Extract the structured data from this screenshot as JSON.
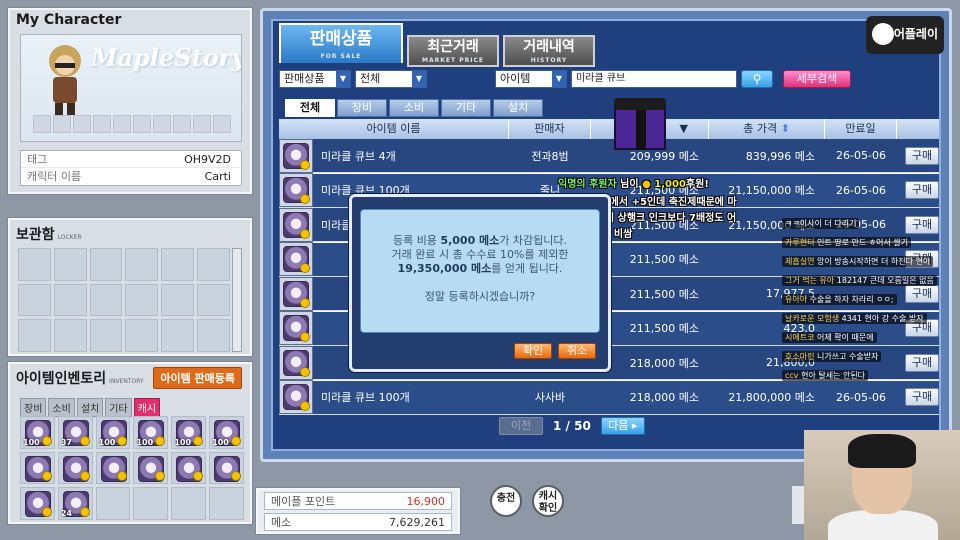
{
  "character": {
    "title": "My Character",
    "watermark": "MapleStory",
    "rows": [
      {
        "key": "태그",
        "value": "OH9V2D"
      },
      {
        "key": "캐릭터 이름",
        "value": "Carti"
      }
    ]
  },
  "locker": {
    "title": "보관함",
    "subtitle": "LOCKER"
  },
  "inventory": {
    "title": "아이템인벤토리",
    "subtitle": "INVENTORY",
    "sell_button": "아이템 판매등록",
    "tabs": [
      "장비",
      "소비",
      "설치",
      "기타",
      "캐시"
    ],
    "active_tab": "캐시",
    "slots": [
      {
        "qty": "100",
        "icon": "cube-icon"
      },
      {
        "qty": "37",
        "icon": "cube-icon"
      },
      {
        "qty": "100",
        "icon": "cube-icon"
      },
      {
        "qty": "100",
        "icon": "cube-icon"
      },
      {
        "qty": "100",
        "icon": "cube-icon"
      },
      {
        "qty": "100",
        "icon": "cube-icon"
      },
      {
        "qty": "",
        "icon": "cube-icon"
      },
      {
        "qty": "",
        "icon": "cube-icon"
      },
      {
        "qty": "",
        "icon": "cube-icon"
      },
      {
        "qty": "",
        "icon": "cube-icon"
      },
      {
        "qty": "",
        "icon": "cube-icon"
      },
      {
        "qty": "",
        "icon": "cube-icon"
      },
      {
        "qty": "",
        "icon": "cube-icon"
      },
      {
        "qty": "24",
        "icon": "cube-icon"
      }
    ]
  },
  "points": {
    "maple_label": "메이플 포인트",
    "maple_value": "16,900",
    "meso_label": "메소",
    "meso_value": "7,629,261"
  },
  "round_buttons": {
    "charge": "충전",
    "cash_check": "캐시\n확인"
  },
  "shop": {
    "tabs": [
      {
        "label": "판매상품",
        "sub": "FOR SALE"
      },
      {
        "label": "최근거래",
        "sub": "MARKET PRICE"
      },
      {
        "label": "거래내역",
        "sub": "HISTORY"
      }
    ],
    "filters": {
      "filter1": "판매상품",
      "filter2": "전체",
      "filter3": "아이템",
      "search_value": "미라클 큐브",
      "detail_search": "세부검색"
    },
    "category_tabs": [
      "전체",
      "장비",
      "소비",
      "기타",
      "설치"
    ],
    "active_category": "전체",
    "columns": [
      "아이템 이름",
      "판매자",
      "",
      "총 가격",
      "만료일"
    ],
    "sort_icon": "sort-arrows-icon",
    "rows": [
      {
        "name": "미라클 큐브 4개",
        "seller": "전과8범",
        "price": "209,999 메소",
        "total": "839,996 메소",
        "expiry": "26-05-06",
        "buy": "구매"
      },
      {
        "name": "미라클 큐브 100개",
        "seller": "줄니",
        "price": "211,500 메소",
        "total": "21,150,000 메소",
        "expiry": "26-05-06",
        "buy": "구매"
      },
      {
        "name": "미라클 큐브 100개",
        "seller": "",
        "price": "211,500 메소",
        "total": "21,150,000 메소",
        "expiry": "26-05-06",
        "buy": "구매"
      },
      {
        "name": "",
        "seller": "",
        "price": "211,500 메소",
        "total": "",
        "expiry": "",
        "buy": "구매"
      },
      {
        "name": "",
        "seller": "",
        "price": "211,500 메소",
        "total": "17,977,5",
        "expiry": "",
        "buy": "구매"
      },
      {
        "name": "",
        "seller": "",
        "price": "211,500 메소",
        "total": "423,0",
        "expiry": "",
        "buy": "구매"
      },
      {
        "name": "",
        "seller": "",
        "price": "218,000 메소",
        "total": "21,800,0",
        "expiry": "",
        "buy": "구매"
      },
      {
        "name": "미라클 큐브 100개",
        "seller": "사사바",
        "price": "218,000 메소",
        "total": "21,800,000 메소",
        "expiry": "26-05-06",
        "buy": "구매"
      }
    ],
    "pager": {
      "prev": "이전",
      "page": "1 / 50",
      "next": "다음"
    }
  },
  "dialog": {
    "line1_pre": "등록 비용 ",
    "line1_amount": "5,000 메소",
    "line1_post": "가 차감됩니다.",
    "line2": "거래 완료 시 총 수수료 10%를 제외한",
    "line3_amount": "19,350,000 메소",
    "line3_post": "를 얻게 됩니다.",
    "question": "정말 등록하시겠습니까?",
    "ok": "확인",
    "cancel": "취소"
  },
  "donation": {
    "name": "익명의 후원자",
    "text_pre": " 님이 ",
    "amount": "1,000",
    "text_post": "후원!",
    "msg1": "현아 아크 블루나 스킬 5에서 +5인데 축진제때문에 마",
    "msg2": "이너스 패널티없음 그러서 상행크 인크보다 7배정도 어",
    "msg3": "크가 비쌈"
  },
  "chat": [
    {
      "user": "",
      "text": "ㅋㅋ이사이 더 다리기"
    },
    {
      "user": "카루현터",
      "text": "인트 땅로 만드 ㅎ어서 쌀기"
    },
    {
      "user": "제흡실연",
      "text": "앙이 방송시작하면 더 하진다 현아"
    },
    {
      "user": "그거 먹는 유아",
      "text": "182147 큰데 오름일은 없음"
    },
    {
      "user": "유아아",
      "text": "수술을 하자 차라리 ㅇㅇ;"
    },
    {
      "user": "날카로운 모험생",
      "text": "4341 현아 강 수술 받자"
    },
    {
      "user": "시에트코",
      "text": "어제 확이 때문에"
    },
    {
      "user": "호소마린",
      "text": "니가쓰고 수술받자"
    },
    {
      "user": "ccv",
      "text": "현아 탈세는 안된다"
    }
  ],
  "logo": "미어플레이"
}
